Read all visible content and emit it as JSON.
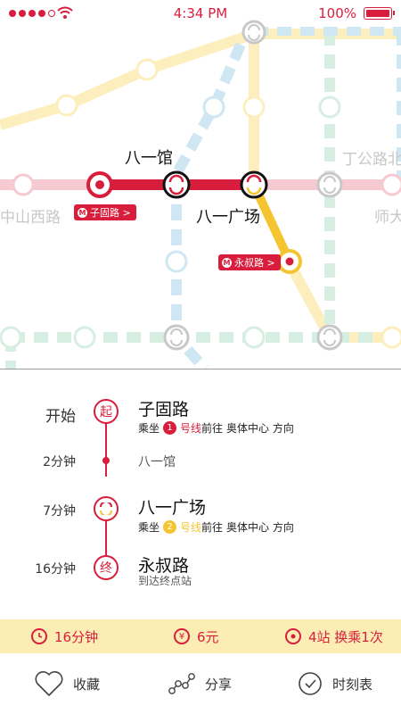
{
  "status_bar": {
    "time": "4:34 PM",
    "battery": "100%",
    "icons": [
      "signal-dots-icon",
      "wifi-icon",
      "battery-icon"
    ]
  },
  "map": {
    "colors": {
      "line1": "#d81e3c",
      "line1_faded": "#f7c9d0",
      "line2": "#f4c531",
      "line2_faded": "#fdeebe",
      "line_blue_faded": "#cfe6f3",
      "line_green_faded": "#d7eee2",
      "grey_station": "#c8c8c8"
    },
    "labels": {
      "bayiguan": "八一馆",
      "bayiguangchang": "八一广场",
      "dinggonglu": "丁公路北",
      "zhongshanxilu": "中山西路",
      "shida": "师大"
    },
    "tags": {
      "origin": "子固路 >",
      "destination": "永叔路 >"
    }
  },
  "route": {
    "steps": [
      {
        "time": "开始",
        "node": "起",
        "station": "子固路",
        "take": "乘坐",
        "line_no": "1",
        "line_label": "号线",
        "toward_prefix": "前往",
        "toward": "奥体中心 方向"
      },
      {
        "time": "2分钟",
        "station": "八一馆"
      },
      {
        "time": "7分钟",
        "station": "八一广场",
        "take": "乘坐",
        "line_no": "2",
        "line_label": "号线",
        "toward_prefix": "前往",
        "toward": "奥体中心 方向"
      },
      {
        "time": "16分钟",
        "node": "终",
        "station": "永叔路",
        "note": "到达终点站"
      }
    ]
  },
  "summary": {
    "duration": "16分钟",
    "fare": "6元",
    "fare_symbol": "¥",
    "stops": "4站 换乘1次"
  },
  "nav": {
    "favorite": "收藏",
    "share": "分享",
    "schedule": "时刻表"
  }
}
